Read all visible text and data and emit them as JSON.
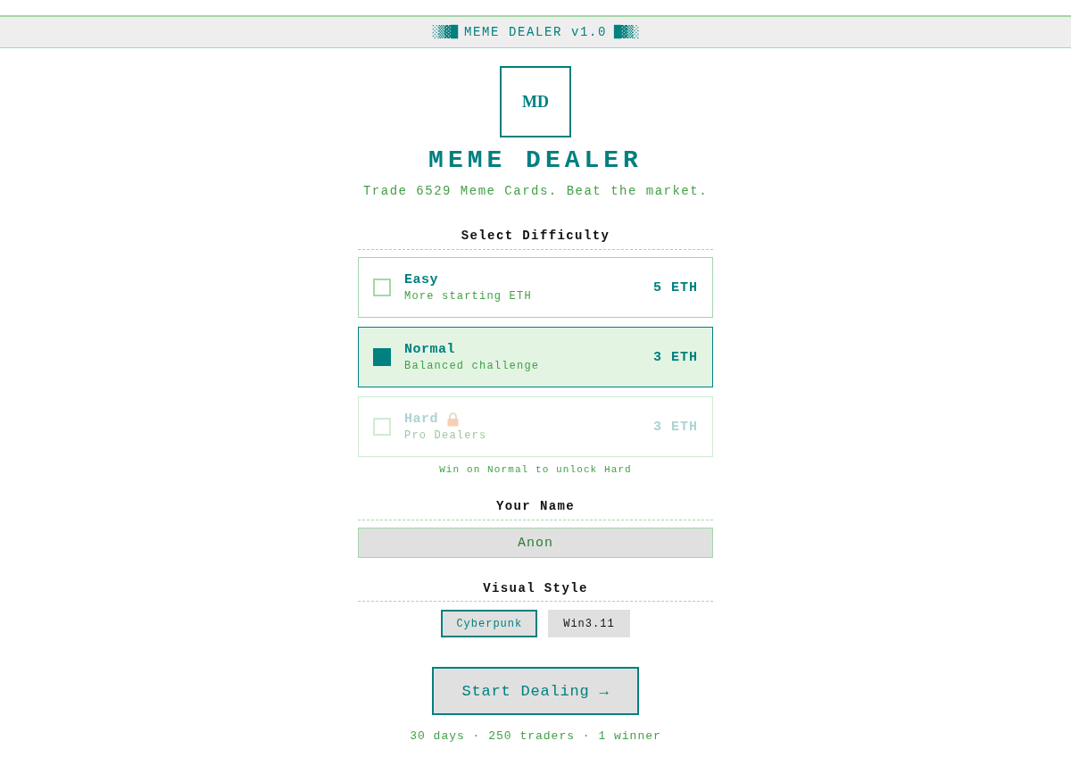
{
  "header": {
    "left_ornament": "░▒▓█",
    "title": "MEME DEALER v1.0",
    "right_ornament": "█▓▒░"
  },
  "logo": {
    "text": "MD"
  },
  "title": "MEME DEALER",
  "tagline": "Trade 6529 Meme Cards. Beat the market.",
  "difficulty": {
    "heading": "Select Difficulty",
    "options": [
      {
        "name": "Easy",
        "description": "More starting ETH",
        "reward": "5 ETH",
        "selected": false,
        "locked": false
      },
      {
        "name": "Normal",
        "description": "Balanced challenge",
        "reward": "3 ETH",
        "selected": true,
        "locked": false
      },
      {
        "name": "Hard",
        "description": "Pro Dealers",
        "reward": "3 ETH",
        "selected": false,
        "locked": true
      }
    ],
    "hint": "Win on Normal to unlock Hard"
  },
  "player_name": {
    "heading": "Your Name",
    "value": "Anon"
  },
  "visual_style": {
    "heading": "Visual Style",
    "options": [
      {
        "label": "Cyberpunk",
        "selected": true
      },
      {
        "label": "Win3.11",
        "selected": false
      }
    ]
  },
  "start_button": {
    "label": "Start Dealing →"
  },
  "footer": "30 days · 250 traders · 1 winner"
}
